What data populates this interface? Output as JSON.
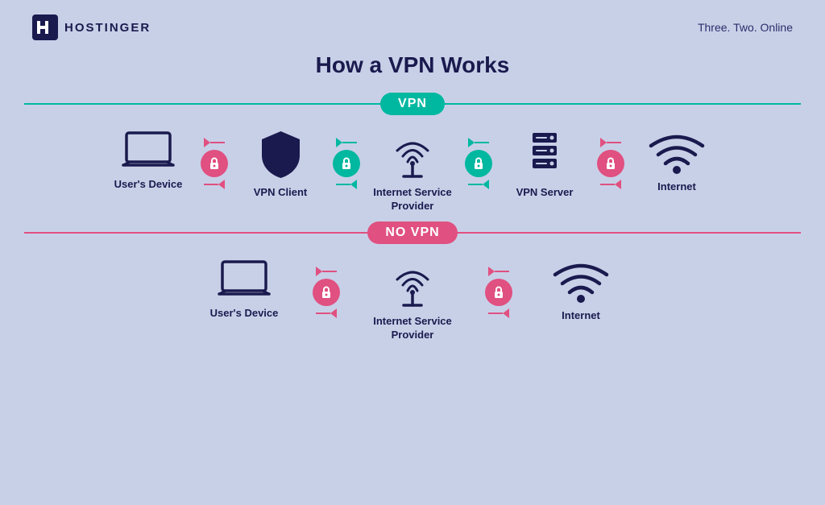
{
  "header": {
    "logo_text": "HOSTINGER",
    "tagline": "Three. Two. Online"
  },
  "main_title": "How a VPN Works",
  "vpn_section": {
    "badge": "VPN",
    "badge_color": "green",
    "items": [
      {
        "label": "User's Device"
      },
      {
        "label": "VPN Client"
      },
      {
        "label": "Internet Service Provider"
      },
      {
        "label": "VPN Server"
      },
      {
        "label": "Internet"
      }
    ],
    "connector_type": "green"
  },
  "novpn_section": {
    "badge": "NO VPN",
    "badge_color": "pink",
    "items": [
      {
        "label": "User's Device"
      },
      {
        "label": "Internet Service Provider"
      },
      {
        "label": "Internet"
      }
    ],
    "connector_type": "pink"
  }
}
